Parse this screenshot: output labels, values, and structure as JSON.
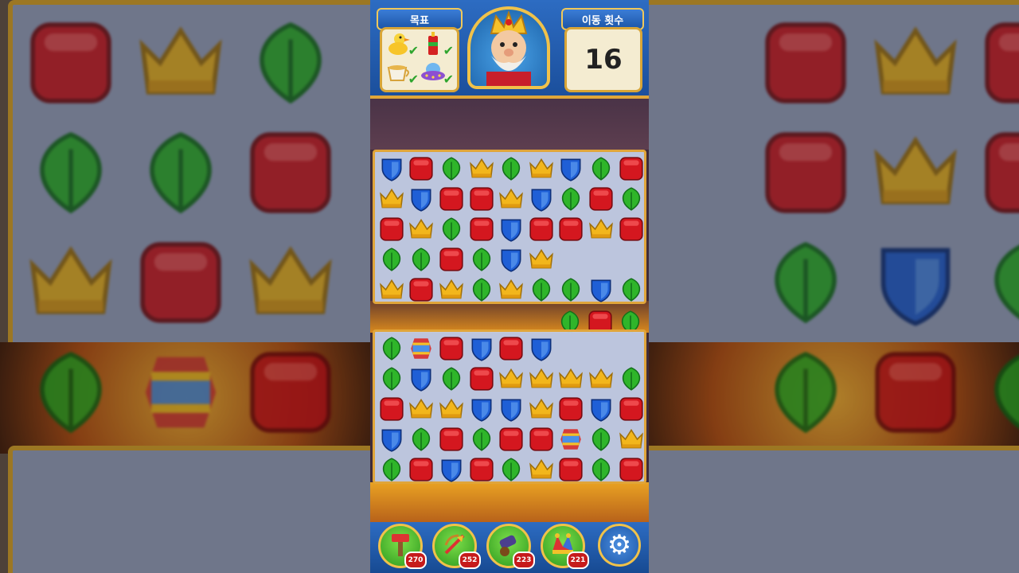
{
  "goal_label": "목표",
  "moves_label": "이동 횟수",
  "moves_value": "16",
  "goals": [
    {
      "icon": "duck-icon",
      "done": true
    },
    {
      "icon": "firework-icon",
      "done": true
    },
    {
      "icon": "teacup-icon",
      "done": true
    },
    {
      "icon": "ufo-icon",
      "done": true
    }
  ],
  "board_top": [
    [
      "B",
      "R",
      "G",
      "C",
      "G",
      "C",
      "B",
      "G",
      "R"
    ],
    [
      "C",
      "B",
      "R",
      "R",
      "C",
      "B",
      "G",
      "R",
      "G"
    ],
    [
      "R",
      "C",
      "G",
      "R",
      "B",
      "R",
      "R",
      "C",
      "R"
    ],
    [
      "G",
      "G",
      "R",
      "G",
      "B",
      "C",
      "",
      "",
      ""
    ],
    [
      "C",
      "R",
      "C",
      "G",
      "C",
      "G",
      "G",
      "B",
      "G"
    ]
  ],
  "board_extra": [
    "G",
    "R",
    "G"
  ],
  "board_bottom": [
    [
      "G",
      "T",
      "R",
      "B",
      "R",
      "B",
      "",
      "",
      ""
    ],
    [
      "G",
      "B",
      "G",
      "R",
      "C",
      "C",
      "C",
      "C",
      "G"
    ],
    [
      "R",
      "C",
      "C",
      "B",
      "B",
      "C",
      "R",
      "B",
      "R"
    ],
    [
      "B",
      "G",
      "R",
      "G",
      "R",
      "R",
      "T",
      "G",
      "C"
    ],
    [
      "G",
      "R",
      "B",
      "R",
      "G",
      "C",
      "R",
      "G",
      "R"
    ]
  ],
  "boosters": [
    {
      "icon": "hammer-icon",
      "count": "270"
    },
    {
      "icon": "arrow-icon",
      "count": "252"
    },
    {
      "icon": "cannon-icon",
      "count": "223"
    },
    {
      "icon": "jester-hat-icon",
      "count": "221"
    }
  ],
  "settings_icon": "gear-icon",
  "colors": {
    "red": "#d4171f",
    "green": "#2fb52a",
    "blue": "#1f5fd6",
    "yellow": "#f2b61c"
  }
}
